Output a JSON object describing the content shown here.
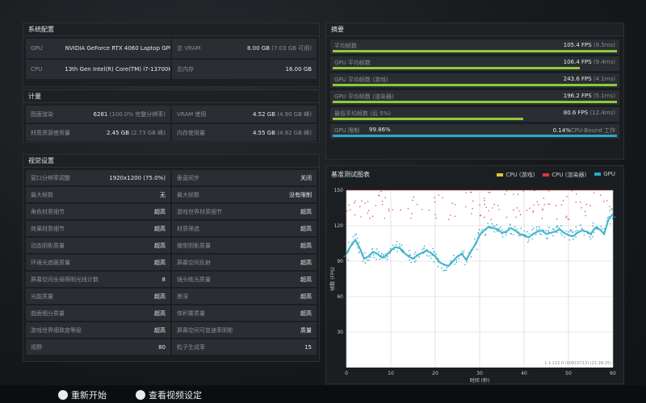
{
  "hardware": {
    "title": "系统配置",
    "gpu_label": "GPU",
    "gpu_name": "NVIDIA GeForce RTX 4060 Laptop GPU",
    "vram_label": "总 VRAM",
    "vram_value": "8.00 GB",
    "vram_sub": "(7.03 GB 可用)",
    "cpu_label": "CPU",
    "cpu_name": "13th Gen Intel(R) Core(TM) i7-13700H",
    "mem_label": "总内存",
    "mem_value": "16.00 GB"
  },
  "metrics": {
    "title": "计量",
    "draw_calls_label": "图面渲染",
    "draw_calls_value": "6281",
    "draw_calls_sub": "(100.0% 完整分辨率)",
    "vram_use_label": "VRAM 使用",
    "vram_use_value": "4.52 GB",
    "vram_use_sub": "(4.90 GB 峰)",
    "mat_mem_label": "材质资源使用量",
    "mat_mem_value": "2.45 GB",
    "mat_mem_sub": "(2.73 GB 峰)",
    "mem_use_label": "内存使用量",
    "mem_use_value": "4.55 GB",
    "mem_use_sub": "(4.92 GB 峰)"
  },
  "settings": {
    "title": "视觉设置",
    "rows": [
      {
        "l1": "窗口分辨率调整",
        "v1": "1920x1200 (75.0%)",
        "l2": "垂直同步",
        "v2": "关闭"
      },
      {
        "l1": "最大帧数",
        "v1": "无",
        "l2": "最大帧数",
        "v2": "没有限制"
      },
      {
        "l1": "角色材质细节",
        "v1": "超高",
        "l2": "游戏世界材质细节",
        "v2": "超高"
      },
      {
        "l1": "效果材质细节",
        "v1": "超高",
        "l2": "材质筛选",
        "v2": "超高"
      },
      {
        "l1": "动态阴影质量",
        "v1": "超高",
        "l2": "微型阴影质量",
        "v2": "超高"
      },
      {
        "l1": "环境光遮蔽质量",
        "v1": "超高",
        "l2": "屏幕空间反射",
        "v2": "超高"
      },
      {
        "l1": "屏幕空间全局照明光线计数",
        "v1": "8",
        "l2": "镜头眩光质量",
        "v2": "超高"
      },
      {
        "l1": "光能质量",
        "v1": "超高",
        "l2": "景深",
        "v2": "超高"
      },
      {
        "l1": "曲面细分质量",
        "v1": "超高",
        "l2": "体积雾质量",
        "v2": "超高"
      },
      {
        "l1": "游戏世界细致度等级",
        "v1": "超高",
        "l2": "屏幕空间可变速率阴影",
        "v2": "质量"
      },
      {
        "l1": "视野",
        "v1": "80",
        "l2": "粒子生成率",
        "v2": "15"
      }
    ]
  },
  "summary": {
    "title": "摘要",
    "items": [
      {
        "label": "平均帧数",
        "value": "105.4 FPS",
        "sub": "(9.5ms)",
        "fraction": 1.0
      },
      {
        "label": "GPU 平均帧数",
        "value": "106.4 FPS",
        "sub": "(9.4ms)",
        "fraction": 0.87
      },
      {
        "label": "GPU 平均帧数 (游戏)",
        "value": "243.6 FPS",
        "sub": "(4.1ms)",
        "fraction": 1.0
      },
      {
        "label": "GPU 平均帧数 (渲染器)",
        "value": "196.2 FPS",
        "sub": "(5.1ms)",
        "fraction": 1.0
      },
      {
        "label": "最低平均帧数 (后 5%)",
        "value": "80.6 FPS",
        "sub": "(12.4ms)",
        "fraction": 0.67
      }
    ],
    "gpu_bound_label": "GPU 限制",
    "gpu_bound_value": "99.86%",
    "cpu_bound_value": "0.14%",
    "cpu_bound_label": "CPU-Bound 工作",
    "gpu_bound_fraction": 0.9986
  },
  "chart_data": {
    "type": "scatter",
    "title": "基准测试图表",
    "xlabel": "时间 (秒)",
    "ylabel": "帧数 (FPS)",
    "xlim": [
      0,
      60
    ],
    "ylim": [
      0,
      150
    ],
    "xticks": [
      0,
      10,
      20,
      30,
      40,
      50,
      60
    ],
    "yticks": [
      30,
      60,
      90,
      120,
      150
    ],
    "grid": true,
    "legend_position": "top-right",
    "watermark": "1.1.122.0 (00910713) (21:28:25)",
    "series": [
      {
        "name": "CPU (游戏)",
        "color": "#e3c53a"
      },
      {
        "name": "CPU (渲染器)",
        "color": "#d8393b"
      },
      {
        "name": "GPU",
        "color": "#2aa9c8",
        "x": [
          0,
          1,
          2,
          3,
          4,
          5,
          6,
          7,
          8,
          9,
          10,
          11,
          12,
          13,
          14,
          15,
          16,
          17,
          18,
          19,
          20,
          21,
          22,
          23,
          24,
          25,
          26,
          27,
          28,
          29,
          30,
          31,
          32,
          33,
          34,
          35,
          36,
          37,
          38,
          39,
          40,
          41,
          42,
          43,
          44,
          45,
          46,
          47,
          48,
          49,
          50,
          51,
          52,
          53,
          54,
          55,
          56,
          57,
          58,
          59,
          60
        ],
        "y": [
          96,
          103,
          108,
          101,
          92,
          94,
          98,
          96,
          93,
          95,
          99,
          102,
          101,
          97,
          94,
          92,
          95,
          97,
          99,
          97,
          94,
          89,
          87,
          86,
          90,
          94,
          96,
          91,
          98,
          104,
          112,
          116,
          119,
          118,
          117,
          114,
          115,
          118,
          116,
          113,
          112,
          110,
          113,
          115,
          116,
          113,
          114,
          115,
          117,
          114,
          112,
          111,
          114,
          116,
          115,
          113,
          118,
          117,
          113,
          125,
          130
        ]
      }
    ],
    "annotation_range": [
      125,
      150
    ]
  },
  "bottom": {
    "restart": "重新开始",
    "view_settings": "查看视频设定"
  },
  "colors": {
    "accent_green": "#8fcb3b",
    "accent_blue": "#2aa9c8",
    "cpu_game": "#e3c53a",
    "cpu_render": "#d8393b"
  }
}
